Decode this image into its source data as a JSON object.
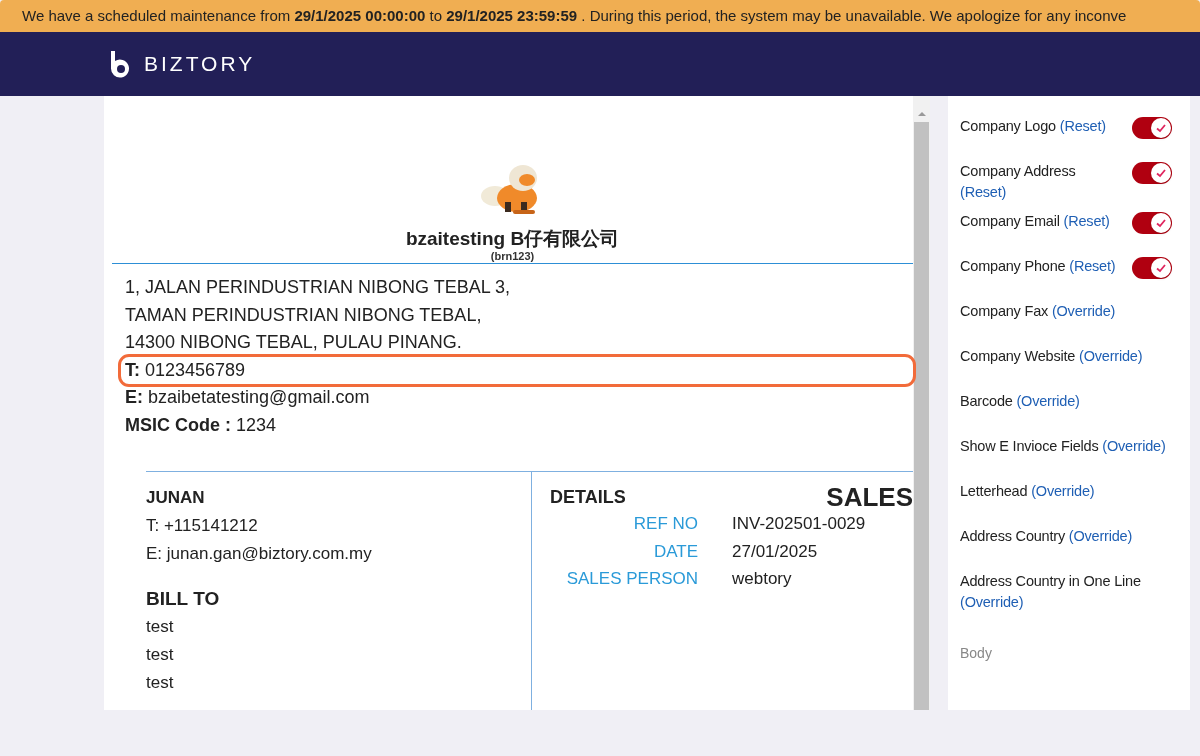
{
  "banner": {
    "text": "We have a scheduled maintenance from **29/1/2025 00:00:00** to **29/1/2025 23:59:59** . During this period, the system may be unavailable. We apologize for any inconve"
  },
  "header": {
    "brand": "BIZTORY"
  },
  "invoice": {
    "company_name": "bzaitesting B仔有限公司",
    "registration": "(brn123)",
    "address_lines": [
      "1, JALAN PERINDUSTRIAN NIBONG TEBAL 3,",
      "TAMAN PERINDUSTRIAN NIBONG TEBAL,",
      "14300 NIBONG TEBAL, PULAU PINANG."
    ],
    "contacts": [
      {
        "label": "T:",
        "value": "0123456789",
        "highlighted": true
      },
      {
        "label": "E:",
        "value": "bzaibetatesting@gmail.com",
        "highlighted": false
      },
      {
        "label": "MSIC Code :",
        "value": "1234",
        "highlighted": false
      }
    ],
    "from": {
      "name": "JUNAN",
      "lines": [
        "T: +115141212",
        "E: junan.gan@biztory.com.my"
      ]
    },
    "bill_to": {
      "heading": "BILL TO",
      "lines": [
        "test",
        "test",
        "test"
      ]
    },
    "details": {
      "heading": "DETAILS",
      "title": "SALES",
      "rows": [
        {
          "label": "REF NO",
          "value": "INV-202501-0029"
        },
        {
          "label": "DATE",
          "value": "27/01/2025"
        },
        {
          "label": "SALES PERSON",
          "value": "webtory"
        }
      ]
    }
  },
  "settings": {
    "items": [
      {
        "label": "Company Logo",
        "action": "(Reset)",
        "kind": "toggle",
        "checked": true
      },
      {
        "label": "Company Address",
        "action": "(Reset)",
        "kind": "toggle",
        "checked": true
      },
      {
        "label": "Company Email",
        "action": "(Reset)",
        "kind": "toggle",
        "checked": true
      },
      {
        "label": "Company Phone",
        "action": "(Reset)",
        "kind": "toggle",
        "checked": true
      },
      {
        "label": "Company Fax",
        "action": "(Override)",
        "kind": "plain"
      },
      {
        "label": "Company Website",
        "action": "(Override)",
        "kind": "plain"
      },
      {
        "label": "Barcode",
        "action": "(Override)",
        "kind": "plain"
      },
      {
        "label": "Show E Invioce Fields",
        "action": "(Override)",
        "kind": "plain"
      },
      {
        "label": "Letterhead",
        "action": "(Override)",
        "kind": "plain"
      },
      {
        "label": "Address Country",
        "action": "(Override)",
        "kind": "plain"
      },
      {
        "label": "Address Country in One Line",
        "action": "(Override)",
        "kind": "plain"
      }
    ],
    "next_section": "Body"
  }
}
